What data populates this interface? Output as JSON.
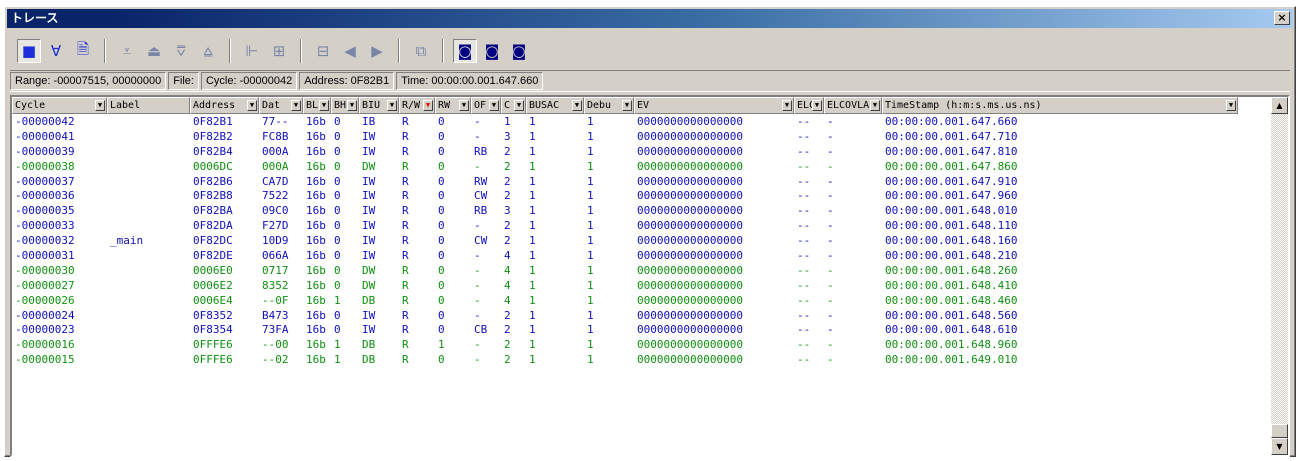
{
  "window": {
    "title": "トレース",
    "close_glyph": "×"
  },
  "toolbar": {
    "buttons": [
      {
        "icon": "display-toggle-icon",
        "glyph": "■",
        "on": true
      },
      {
        "icon": "filter-icon",
        "glyph": "∀"
      },
      {
        "icon": "document-icon",
        "glyph": "🗎"
      },
      {
        "icon": "sep"
      },
      {
        "icon": "trigger-down-icon",
        "glyph": "⩡"
      },
      {
        "icon": "trigger-up-icon",
        "glyph": "⏏"
      },
      {
        "icon": "range-down-icon",
        "glyph": "⩢"
      },
      {
        "icon": "range-up-icon",
        "glyph": "⩠"
      },
      {
        "icon": "sep"
      },
      {
        "icon": "tree-icon",
        "glyph": "⊩"
      },
      {
        "icon": "expand-icon",
        "glyph": "⊞"
      },
      {
        "icon": "sep"
      },
      {
        "icon": "list-icon",
        "glyph": "⊟"
      },
      {
        "icon": "step-back-icon",
        "glyph": "◀"
      },
      {
        "icon": "step-forward-icon",
        "glyph": "▶"
      },
      {
        "icon": "sep"
      },
      {
        "icon": "properties-icon",
        "glyph": "⧉"
      },
      {
        "icon": "sep"
      },
      {
        "icon": "search-icon",
        "glyph": "◙",
        "on": true
      },
      {
        "icon": "search-prev-icon",
        "glyph": "◙"
      },
      {
        "icon": "search-next-icon",
        "glyph": "◙"
      }
    ]
  },
  "status": {
    "range": "Range: -00007515, 00000000",
    "file": "File:",
    "cycle": "Cycle: -00000042",
    "address": "Address: 0F82B1",
    "time": "Time: 00:00:00.001.647.660"
  },
  "columns": [
    "Cycle",
    "Label",
    "Address",
    "Dat",
    "BL",
    "BH",
    "BIU",
    "R/W",
    "RW",
    "OF",
    "C",
    "BUSAC",
    "Debu",
    "EV",
    "ELC",
    "ELCOVLA",
    "TimeStamp (h:m:s.ms.us.ns)"
  ],
  "rows": [
    {
      "color": "blue",
      "cells": [
        "-00000042",
        "",
        "0F82B1",
        "77--",
        "16b",
        "0",
        "IB",
        "R",
        "0",
        "-",
        "1",
        "1",
        "1",
        "0000000000000000",
        "--",
        "-",
        "00:00:00.001.647.660"
      ]
    },
    {
      "color": "blue",
      "cells": [
        "-00000041",
        "",
        "0F82B2",
        "FC8B",
        "16b",
        "0",
        "IW",
        "R",
        "0",
        "-",
        "3",
        "1",
        "1",
        "0000000000000000",
        "--",
        "-",
        "00:00:00.001.647.710"
      ]
    },
    {
      "color": "blue",
      "cells": [
        "-00000039",
        "",
        "0F82B4",
        "000A",
        "16b",
        "0",
        "IW",
        "R",
        "0",
        "RB",
        "2",
        "1",
        "1",
        "0000000000000000",
        "--",
        "-",
        "00:00:00.001.647.810"
      ]
    },
    {
      "color": "green",
      "cells": [
        "-00000038",
        "",
        "0006DC",
        "000A",
        "16b",
        "0",
        "DW",
        "R",
        "0",
        "-",
        "2",
        "1",
        "1",
        "0000000000000000",
        "--",
        "-",
        "00:00:00.001.647.860"
      ]
    },
    {
      "color": "blue",
      "cells": [
        "-00000037",
        "",
        "0F82B6",
        "CA7D",
        "16b",
        "0",
        "IW",
        "R",
        "0",
        "RW",
        "2",
        "1",
        "1",
        "0000000000000000",
        "--",
        "-",
        "00:00:00.001.647.910"
      ]
    },
    {
      "color": "blue",
      "cells": [
        "-00000036",
        "",
        "0F82B8",
        "7522",
        "16b",
        "0",
        "IW",
        "R",
        "0",
        "CW",
        "2",
        "1",
        "1",
        "0000000000000000",
        "--",
        "-",
        "00:00:00.001.647.960"
      ]
    },
    {
      "color": "blue",
      "cells": [
        "-00000035",
        "",
        "0F82BA",
        "09C0",
        "16b",
        "0",
        "IW",
        "R",
        "0",
        "RB",
        "3",
        "1",
        "1",
        "0000000000000000",
        "--",
        "-",
        "00:00:00.001.648.010"
      ]
    },
    {
      "color": "blue",
      "cells": [
        "-00000033",
        "",
        "0F82DA",
        "F27D",
        "16b",
        "0",
        "IW",
        "R",
        "0",
        "-",
        "2",
        "1",
        "1",
        "0000000000000000",
        "--",
        "-",
        "00:00:00.001.648.110"
      ]
    },
    {
      "color": "blue",
      "cells": [
        "-00000032",
        "_main",
        "0F82DC",
        "10D9",
        "16b",
        "0",
        "IW",
        "R",
        "0",
        "CW",
        "2",
        "1",
        "1",
        "0000000000000000",
        "--",
        "-",
        "00:00:00.001.648.160"
      ]
    },
    {
      "color": "blue",
      "cells": [
        "-00000031",
        "",
        "0F82DE",
        "066A",
        "16b",
        "0",
        "IW",
        "R",
        "0",
        "-",
        "4",
        "1",
        "1",
        "0000000000000000",
        "--",
        "-",
        "00:00:00.001.648.210"
      ]
    },
    {
      "color": "green",
      "cells": [
        "-00000030",
        "",
        "0006E0",
        "0717",
        "16b",
        "0",
        "DW",
        "R",
        "0",
        "-",
        "4",
        "1",
        "1",
        "0000000000000000",
        "--",
        "-",
        "00:00:00.001.648.260"
      ]
    },
    {
      "color": "green",
      "cells": [
        "-00000027",
        "",
        "0006E2",
        "8352",
        "16b",
        "0",
        "DW",
        "R",
        "0",
        "-",
        "4",
        "1",
        "1",
        "0000000000000000",
        "--",
        "-",
        "00:00:00.001.648.410"
      ]
    },
    {
      "color": "green",
      "cells": [
        "-00000026",
        "",
        "0006E4",
        "--0F",
        "16b",
        "1",
        "DB",
        "R",
        "0",
        "-",
        "4",
        "1",
        "1",
        "0000000000000000",
        "--",
        "-",
        "00:00:00.001.648.460"
      ]
    },
    {
      "color": "blue",
      "cells": [
        "-00000024",
        "",
        "0F8352",
        "B473",
        "16b",
        "0",
        "IW",
        "R",
        "0",
        "-",
        "2",
        "1",
        "1",
        "0000000000000000",
        "--",
        "-",
        "00:00:00.001.648.560"
      ]
    },
    {
      "color": "blue",
      "cells": [
        "-00000023",
        "",
        "0F8354",
        "73FA",
        "16b",
        "0",
        "IW",
        "R",
        "0",
        "CB",
        "2",
        "1",
        "1",
        "0000000000000000",
        "--",
        "-",
        "00:00:00.001.648.610"
      ]
    },
    {
      "color": "green",
      "cells": [
        "-00000016",
        "",
        "0FFFE6",
        "--00",
        "16b",
        "1",
        "DB",
        "R",
        "1",
        "-",
        "2",
        "1",
        "1",
        "0000000000000000",
        "--",
        "-",
        "00:00:00.001.648.960"
      ]
    },
    {
      "color": "green",
      "cells": [
        "-00000015",
        "",
        "0FFFE6",
        "--02",
        "16b",
        "1",
        "DB",
        "R",
        "0",
        "-",
        "2",
        "1",
        "1",
        "0000000000000000",
        "--",
        "-",
        "00:00:00.001.649.010"
      ]
    }
  ],
  "scrollbar": {
    "up_glyph": "▲",
    "down_glyph": "▼"
  }
}
